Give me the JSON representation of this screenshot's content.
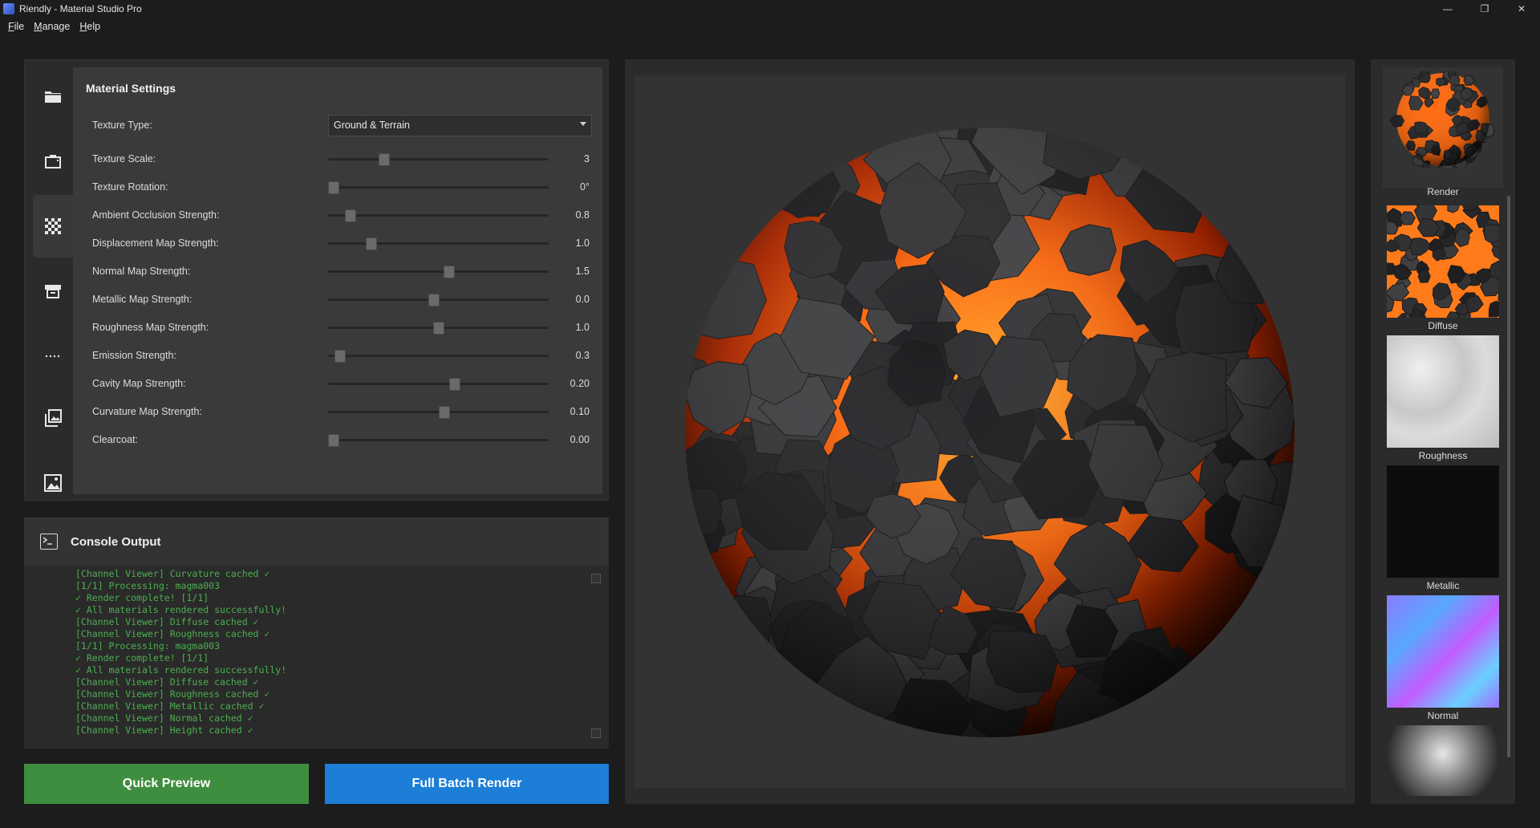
{
  "window": {
    "title": "Riendly - Material Studio Pro",
    "controls": [
      "—",
      "❐",
      "✕"
    ]
  },
  "menu": [
    "File",
    "Manage",
    "Help"
  ],
  "sidebar": {
    "items": [
      {
        "icon": "folder-icon"
      },
      {
        "icon": "camera-icon"
      },
      {
        "icon": "checker-icon",
        "active": true
      },
      {
        "icon": "print-icon"
      },
      {
        "icon": "dots-icon"
      },
      {
        "icon": "gallery-icon"
      },
      {
        "icon": "image-icon"
      }
    ]
  },
  "settings": {
    "title": "Material Settings",
    "texture_type": {
      "label": "Texture Type:",
      "value": "Ground & Terrain"
    },
    "sliders": [
      {
        "label": "Texture Scale:",
        "value": "3",
        "fraction": 0.24
      },
      {
        "label": "Texture Rotation:",
        "value": "0°",
        "fraction": 0.0
      },
      {
        "label": "Ambient Occlusion Strength:",
        "value": "0.8",
        "fraction": 0.08
      },
      {
        "label": "Displacement Map Strength:",
        "value": "1.0",
        "fraction": 0.18
      },
      {
        "label": "Normal Map Strength:",
        "value": "1.5",
        "fraction": 0.55
      },
      {
        "label": "Metallic Map Strength:",
        "value": "0.0",
        "fraction": 0.48
      },
      {
        "label": "Roughness Map Strength:",
        "value": "1.0",
        "fraction": 0.5
      },
      {
        "label": "Emission Strength:",
        "value": "0.3",
        "fraction": 0.03
      },
      {
        "label": "Cavity Map Strength:",
        "value": "0.20",
        "fraction": 0.58
      },
      {
        "label": "Curvature Map Strength:",
        "value": "0.10",
        "fraction": 0.53
      },
      {
        "label": "Clearcoat:",
        "value": "0.00",
        "fraction": 0.0
      }
    ]
  },
  "console": {
    "title": "Console Output",
    "lines": [
      "[Channel Viewer] Curvature cached ✓",
      "[1/1] Processing: magma003",
      "✓ Render complete! [1/1]",
      "✓ All materials rendered successfully!",
      "[Channel Viewer] Diffuse cached ✓",
      "[Channel Viewer] Roughness cached ✓",
      "[1/1] Processing: magma003",
      "✓ Render complete! [1/1]",
      "✓ All materials rendered successfully!",
      "[Channel Viewer] Diffuse cached ✓",
      "[Channel Viewer] Roughness cached ✓",
      "[Channel Viewer] Metallic cached ✓",
      "[Channel Viewer] Normal cached ✓",
      "[Channel Viewer] Height cached ✓"
    ]
  },
  "buttons": {
    "quick_preview": "Quick Preview",
    "full_batch": "Full Batch Render"
  },
  "channels": [
    {
      "label": "Render"
    },
    {
      "label": "Diffuse"
    },
    {
      "label": "Roughness"
    },
    {
      "label": "Metallic"
    },
    {
      "label": "Normal"
    },
    {
      "label": ""
    }
  ],
  "colors": {
    "quick_preview": "#3f8e3f",
    "full_batch": "#1c7ed6",
    "console_text": "#4caf50",
    "lava": "#ff7a1a"
  }
}
